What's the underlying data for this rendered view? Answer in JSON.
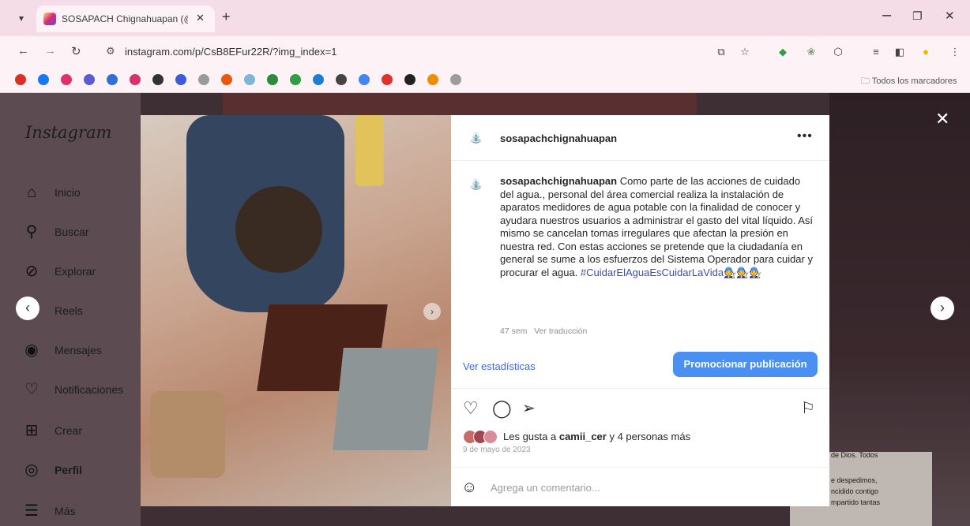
{
  "browser": {
    "tab_title": "SOSAPACH Chignahuapan (@",
    "url": "instagram.com/p/CsB8EFur22R/?img_index=1",
    "all_bookmarks_label": "Todos los marcadores",
    "bookmark_colors": [
      "#d93025",
      "#1877f2",
      "#e1306c",
      "#5b5bd6",
      "#2f6fd6",
      "#d6336c",
      "#333333",
      "#3b5bdb",
      "#9a9a9a",
      "#e8590c",
      "#7fb5d5",
      "#2b8a3e",
      "#2f9e44",
      "#1c7ed6",
      "#444444",
      "#4285f4",
      "#e03131",
      "#222222",
      "#f08c00",
      "#9c9c9c"
    ]
  },
  "sidebar": {
    "logo": "Instagram",
    "items": [
      {
        "label": "Inicio",
        "icon": "home-icon"
      },
      {
        "label": "Buscar",
        "icon": "search-icon"
      },
      {
        "label": "Explorar",
        "icon": "compass-icon"
      },
      {
        "label": "Reels",
        "icon": "reels-icon"
      },
      {
        "label": "Mensajes",
        "icon": "messenger-icon"
      },
      {
        "label": "Notificaciones",
        "icon": "heart-icon"
      },
      {
        "label": "Crear",
        "icon": "plus-square-icon"
      },
      {
        "label": "Perfil",
        "icon": "profile-icon"
      },
      {
        "label": "Más",
        "icon": "menu-icon"
      }
    ]
  },
  "post": {
    "username": "sosapachchignahuapan",
    "caption_text": "Como parte de las acciones de cuidado del agua., personal del área comercial realiza la instalación de aparatos medidores de agua potable con la finalidad de conocer y ayudara nuestros usuarios a administrar el gasto del vital líquido. Así mismo se cancelan tomas irregulares que afectan la presión en nuestra red. Con estas acciones se pretende que la ciudadanía en general se sume a los esfuerzos del Sistema Operador para cuidar y procurar el agua.",
    "hashtag": "#CuidarElAguaEsCuidarLaVida",
    "hashtag_emojis": "🧑‍🔧🧑‍🔧🧑‍🔧",
    "age": "47 sem",
    "translate_label": "Ver traducción",
    "stats_label": "Ver estadísticas",
    "promote_label": "Promocionar publicación",
    "likes_prefix": "Les gusta a",
    "likes_user": "camii_cer",
    "likes_suffix": "y 4 personas más",
    "date": "9 de mayo de 2023",
    "comment_placeholder": "Agrega un comentario..."
  },
  "background": {
    "caption_line": "de Dios. Todos",
    "notice_lines": [
      "e despedimos,",
      "ncidido contigo",
      "mpartido tantas"
    ]
  },
  "colors": {
    "accent_blue": "#4a8ff2",
    "link_blue": "#3f6ad8",
    "hashtag_blue": "#3b4ea8"
  }
}
